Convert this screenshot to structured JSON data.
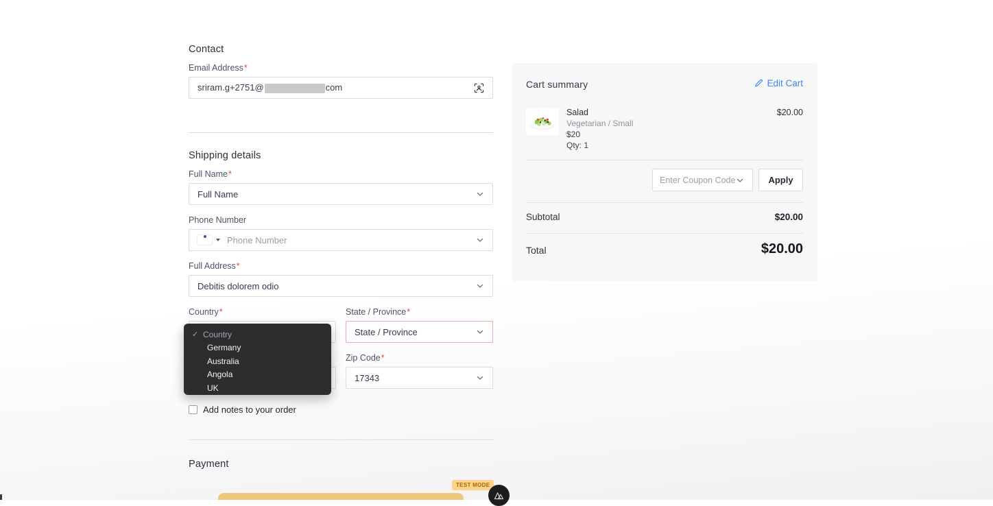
{
  "contact": {
    "heading": "Contact",
    "email": {
      "label": "Email Address",
      "required_mark": "*",
      "value_prefix": "sriram.g+2751@",
      "value_suffix": "com"
    }
  },
  "shipping": {
    "heading": "Shipping details",
    "full_name": {
      "label": "Full Name",
      "required_mark": "*",
      "value": "Full Name"
    },
    "phone": {
      "label": "Phone Number",
      "placeholder": "Phone Number",
      "flag": "india-flag"
    },
    "full_address": {
      "label": "Full Address",
      "required_mark": "*",
      "value": "Debitis dolorem odio"
    },
    "country": {
      "label": "Country",
      "required_mark": "*",
      "dropdown": {
        "selected": "Country",
        "options": [
          "Country",
          "Germany",
          "Australia",
          "Angola",
          "UK"
        ]
      }
    },
    "state": {
      "label": "State / Province",
      "required_mark": "*",
      "value": "State / Province"
    },
    "zip": {
      "label": "Zip Code",
      "required_mark": "*",
      "value": "17343"
    },
    "notes_checkbox_label": "Add notes to your order"
  },
  "payment": {
    "heading": "Payment",
    "test_mode_badge": "TEST MODE"
  },
  "cart": {
    "heading": "Cart summary",
    "edit_link": "Edit Cart",
    "item": {
      "name": "Salad",
      "variant": "Vegetarian / Small",
      "unit_price": "$20",
      "qty": "Qty: 1",
      "line_total": "$20.00"
    },
    "coupon": {
      "placeholder": "Enter Coupon Code",
      "apply_label": "Apply"
    },
    "subtotal_label": "Subtotal",
    "subtotal_value": "$20.00",
    "total_label": "Total",
    "total_value": "$20.00"
  },
  "icons": {
    "check": "✓"
  },
  "colors": {
    "link_blue": "#4184f3",
    "error_border": "#f0a9a3",
    "required_red": "#e8483f",
    "popup_bg": "#2d2d2f",
    "badge_bg": "#fcd387",
    "badge_text": "#a96a08",
    "pay_bar": "#edc77d",
    "panel_bg": "#f7f7f8"
  }
}
